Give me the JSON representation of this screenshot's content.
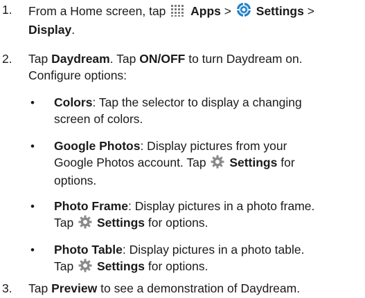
{
  "steps": [
    {
      "number": "1.",
      "text_a": "From a Home screen, tap",
      "apps_icon": "apps-grid-icon",
      "apps_label": "Apps",
      "sep1": ">",
      "settings_icon": "settings-gear-icon",
      "settings_label": "Settings",
      "sep2": ">",
      "display_label": "Display",
      "end": "."
    },
    {
      "number": "2.",
      "line1_a": "Tap",
      "daydream_label": "Daydream",
      "line1_b": ". Tap",
      "onoff_label": "ON/OFF",
      "line1_c": "to turn Daydream on.",
      "line2": "Configure options:"
    },
    {
      "number": "3.",
      "text_a": "Tap",
      "preview_label": "Preview",
      "text_b": "to see a demonstration of Daydream."
    }
  ],
  "options": [
    {
      "title": "Colors",
      "line1": ": Tap the selector to display a changing",
      "line2": "screen of colors."
    },
    {
      "title": "Google Photos",
      "line1": ": Display pictures from your",
      "line2": "Google Photos account. Tap",
      "settings_label": "Settings",
      "line2_end": "for",
      "line3": "options."
    },
    {
      "title": "Photo Frame",
      "line1": ": Display pictures in a photo frame.",
      "line2_a": "Tap",
      "settings_label": "Settings",
      "line2_b": "for options."
    },
    {
      "title": "Photo Table",
      "line1": ": Display pictures in a photo table.",
      "line2_a": "Tap",
      "settings_label": "Settings",
      "line2_b": "for options."
    }
  ],
  "bullet_char": "•",
  "colors": {
    "text": "#1a1a1a",
    "apps_icon": "#7a7a7a",
    "settings_blue": "#1e7fc7",
    "gear_gray": "#8a8a8a"
  }
}
